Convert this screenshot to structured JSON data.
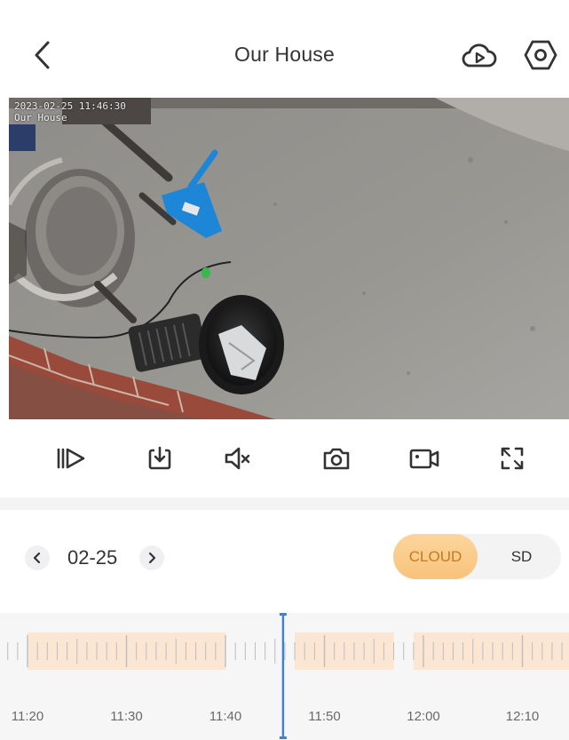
{
  "header": {
    "title": "Our House",
    "icons": {
      "back": "chevron-left-icon",
      "cloud_playback": "cloud-play-icon",
      "settings": "hexagon-settings-icon"
    }
  },
  "video": {
    "osd_time": "2023-02-25 11:46:30",
    "osd_name": "Our House"
  },
  "controls": [
    {
      "name": "playback-speed-button",
      "icon": "play-bar-icon"
    },
    {
      "name": "download-button",
      "icon": "download-icon"
    },
    {
      "name": "mute-button",
      "icon": "speaker-mute-icon"
    },
    {
      "name": "snapshot-button",
      "icon": "camera-icon"
    },
    {
      "name": "record-button",
      "icon": "video-camera-icon"
    },
    {
      "name": "fullscreen-button",
      "icon": "expand-icon"
    }
  ],
  "date_nav": {
    "date": "02-25",
    "prev_icon": "chevron-left-icon",
    "next_icon": "chevron-right-icon"
  },
  "source_toggle": {
    "options": [
      "CLOUD",
      "SD"
    ],
    "selected": "CLOUD"
  },
  "timeline": {
    "labels": [
      "11:20",
      "11:30",
      "11:40",
      "11:50",
      "12:00",
      "12:10"
    ],
    "playhead": "11:46",
    "recorded_segments": [
      [
        "11:20",
        "11:40"
      ],
      [
        "11:47",
        "11:57"
      ],
      [
        "11:59",
        "12:15"
      ]
    ]
  },
  "colors": {
    "accent_cloud_text": "#c97b1a",
    "cloud_bg": "#f8c37a",
    "segment": "#fbe5d3",
    "playhead": "#3f7fd8"
  }
}
